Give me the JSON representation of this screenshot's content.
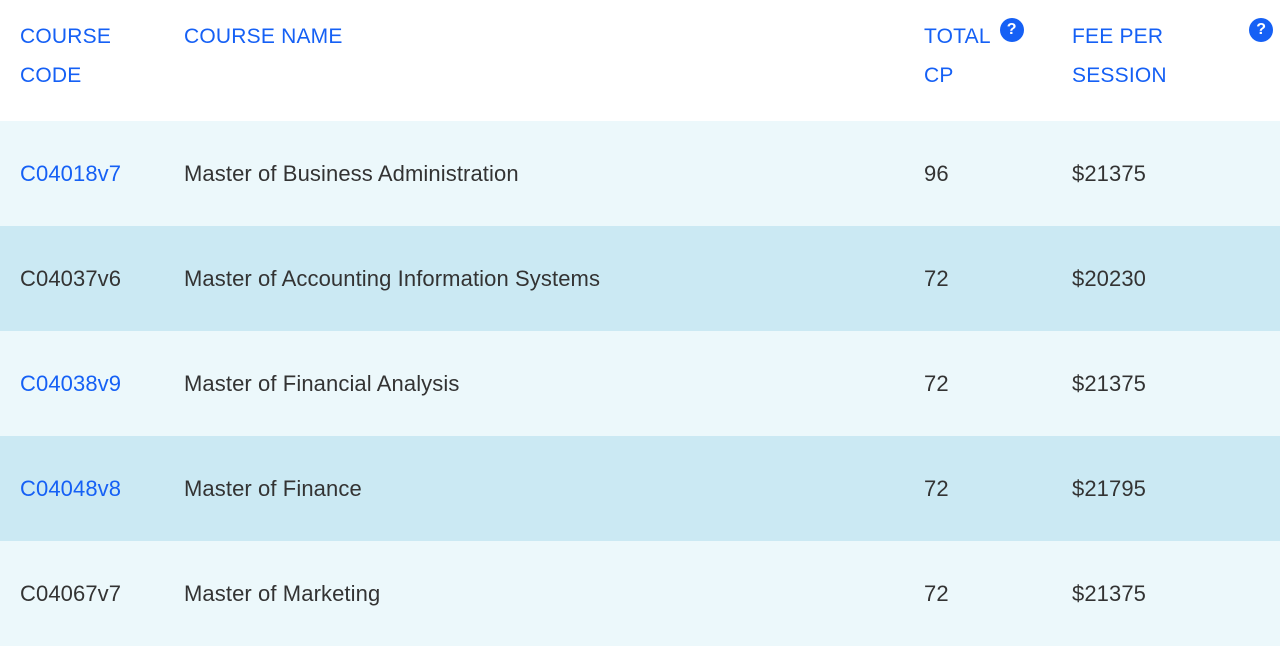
{
  "table": {
    "columns": [
      {
        "key": "course_code",
        "label_lines": [
          "COURSE",
          "CODE"
        ],
        "help": false
      },
      {
        "key": "course_name",
        "label_lines": [
          "COURSE NAME",
          ""
        ],
        "help": false
      },
      {
        "key": "total_cp",
        "label_lines": [
          "TOTAL",
          "CP"
        ],
        "help": true,
        "help_label": "?"
      },
      {
        "key": "fee_per_session",
        "label_lines": [
          "FEE PER",
          "SESSION"
        ],
        "help": true,
        "help_label": "?"
      }
    ],
    "header": {
      "course_code_line1": "COURSE",
      "course_code_line2": "CODE",
      "course_name_line1": "COURSE NAME",
      "total_cp_line1": "TOTAL",
      "total_cp_line2": "CP",
      "fee_line1": "FEE PER",
      "fee_line2": "SESSION",
      "help_glyph": "?"
    },
    "rows": [
      {
        "course_code": "C04018v7",
        "code_is_link": true,
        "course_name": "Master of Business Administration",
        "total_cp": "96",
        "fee_per_session": "$21375",
        "stripe": "light"
      },
      {
        "course_code": "C04037v6",
        "code_is_link": false,
        "course_name": "Master of Accounting Information Systems",
        "total_cp": "72",
        "fee_per_session": "$20230",
        "stripe": "dark"
      },
      {
        "course_code": "C04038v9",
        "code_is_link": true,
        "course_name": "Master of Financial Analysis",
        "total_cp": "72",
        "fee_per_session": "$21375",
        "stripe": "light"
      },
      {
        "course_code": "C04048v8",
        "code_is_link": true,
        "course_name": "Master of Finance",
        "total_cp": "72",
        "fee_per_session": "$21795",
        "stripe": "dark"
      },
      {
        "course_code": "C04067v7",
        "code_is_link": false,
        "course_name": "Master of Marketing",
        "total_cp": "72",
        "fee_per_session": "$21375",
        "stripe": "light"
      }
    ]
  },
  "colors": {
    "link_blue": "#1560f5",
    "header_blue": "#1560f5",
    "row_light": "#ecf8fb",
    "row_dark": "#cbe9f3",
    "text_dark": "#333333",
    "background": "#ffffff"
  }
}
